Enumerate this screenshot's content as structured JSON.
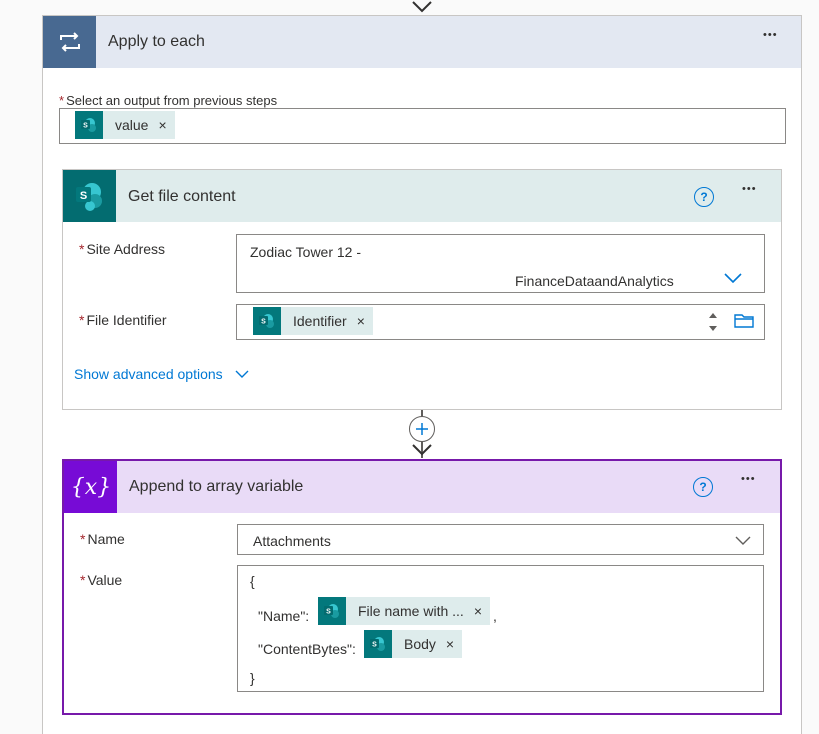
{
  "apply_each": {
    "title": "Apply to each",
    "output_label": "Select an output from previous steps",
    "output_token": "value"
  },
  "get_file": {
    "title": "Get file content",
    "site_address_label": "Site Address",
    "site_address_line1": "Zodiac Tower 12 -",
    "site_address_line2": "FinanceDataandAnalytics",
    "file_identifier_label": "File Identifier",
    "file_identifier_token": "Identifier",
    "advanced": "Show advanced options"
  },
  "append": {
    "title": "Append to array variable",
    "name_label": "Name",
    "name_value": "Attachments",
    "value_label": "Value",
    "open_brace": "{",
    "name_key": "\"Name\":",
    "name_token": "File name with ...",
    "comma": ",",
    "bytes_key": "\"ContentBytes\":",
    "bytes_token": "Body",
    "close_brace": "}"
  },
  "common": {
    "required_mark": "*",
    "remove_mark": "×",
    "more_mark": "•••",
    "help_mark": "?"
  },
  "icons": {
    "loop": "loop-icon",
    "sharepoint": "sharepoint-icon",
    "variable": "variable-icon"
  },
  "colors": {
    "loop_header": "#e3e8f2",
    "loop_icon_bg": "#486991",
    "sharepoint_header": "#dfecec",
    "sharepoint_icon_bg": "#036c70",
    "variable_header": "#e9dbf7",
    "variable_icon_bg": "#770bd6",
    "link": "#0078d4"
  }
}
